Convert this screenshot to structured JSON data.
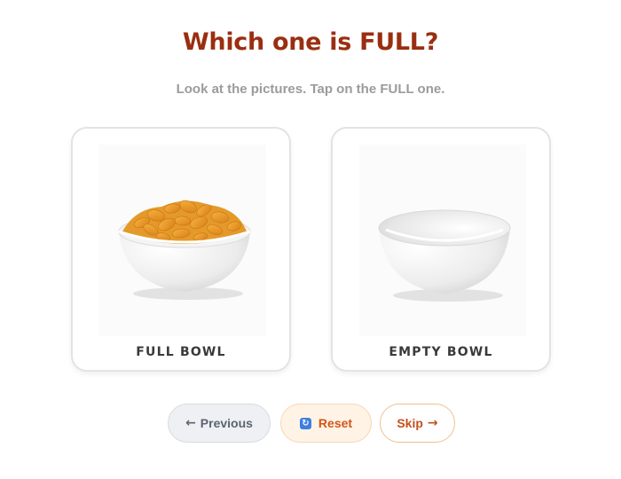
{
  "header": {
    "title": "Which one is FULL?",
    "instruction": "Look at the pictures. Tap on the FULL one."
  },
  "options": [
    {
      "label": "FULL BOWL",
      "image": "bowl-of-cereal"
    },
    {
      "label": "EMPTY BOWL",
      "image": "empty-white-bowl"
    }
  ],
  "nav": {
    "previous_arrow": "←",
    "previous_label": "Previous",
    "reset_icon": "↻",
    "reset_label": "Reset",
    "skip_label": "Skip",
    "skip_arrow": "→"
  },
  "colors": {
    "title": "#9a2e10",
    "accent_orange": "#d2561a",
    "reset_icon_blue": "#3d7fe0"
  }
}
